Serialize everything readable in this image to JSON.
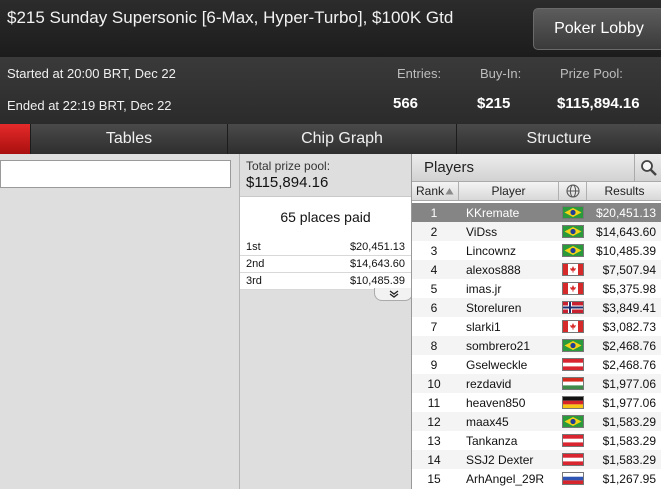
{
  "header": {
    "title": "$215 Sunday Supersonic [6-Max, Hyper-Turbo], $100K Gtd",
    "lobby_button": "Poker Lobby"
  },
  "info": {
    "started": "Started at 20:00 BRT, Dec 22",
    "ended": "Ended at 22:19 BRT, Dec 22",
    "entries_label": "Entries:",
    "entries_value": "566",
    "buyin_label": "Buy-In:",
    "buyin_value": "$215",
    "prizepool_label": "Prize Pool:",
    "prizepool_value": "$115,894.16"
  },
  "tabs": [
    {
      "label": ""
    },
    {
      "label": "Tables"
    },
    {
      "label": "Chip Graph"
    },
    {
      "label": "Structure"
    }
  ],
  "prize_panel": {
    "total_label": "Total prize pool:",
    "total_value": "$115,894.16",
    "places_paid": "65 places paid",
    "payouts": [
      {
        "place": "1st",
        "amount": "$20,451.13"
      },
      {
        "place": "2nd",
        "amount": "$14,643.60"
      },
      {
        "place": "3rd",
        "amount": "$10,485.39"
      }
    ]
  },
  "players": {
    "title": "Players",
    "columns": {
      "rank": "Rank",
      "player": "Player",
      "results": "Results"
    },
    "rows": [
      {
        "rank": "1",
        "name": "KKremate",
        "flag": "brazil-flag-icon",
        "result": "$20,451.13"
      },
      {
        "rank": "2",
        "name": "ViDss",
        "flag": "brazil-flag-icon",
        "result": "$14,643.60"
      },
      {
        "rank": "3",
        "name": "Lincownz",
        "flag": "brazil-flag-icon",
        "result": "$10,485.39"
      },
      {
        "rank": "4",
        "name": "alexos888",
        "flag": "canada-flag-icon",
        "result": "$7,507.94"
      },
      {
        "rank": "5",
        "name": "imas.jr",
        "flag": "canada-flag-icon",
        "result": "$5,375.98"
      },
      {
        "rank": "6",
        "name": "Storeluren",
        "flag": "norway-flag-icon",
        "result": "$3,849.41"
      },
      {
        "rank": "7",
        "name": "slarki1",
        "flag": "canada-flag-icon",
        "result": "$3,082.73"
      },
      {
        "rank": "8",
        "name": "sombrero21",
        "flag": "brazil-flag-icon",
        "result": "$2,468.76"
      },
      {
        "rank": "9",
        "name": "Gselweckle",
        "flag": "austria-flag-icon",
        "result": "$2,468.76"
      },
      {
        "rank": "10",
        "name": "rezdavid",
        "flag": "hungary-flag-icon",
        "result": "$1,977.06"
      },
      {
        "rank": "11",
        "name": "heaven850",
        "flag": "germany-flag-icon",
        "result": "$1,977.06"
      },
      {
        "rank": "12",
        "name": "maax45",
        "flag": "brazil-flag-icon",
        "result": "$1,583.29"
      },
      {
        "rank": "13",
        "name": "Tankanza",
        "flag": "austria-flag-icon",
        "result": "$1,583.29"
      },
      {
        "rank": "14",
        "name": "SSJ2 Dexter",
        "flag": "austria-flag-icon",
        "result": "$1,583.29"
      },
      {
        "rank": "15",
        "name": "ArhAngel_29R",
        "flag": "russia-flag-icon",
        "result": "$1,267.95"
      }
    ]
  },
  "colors": {
    "accent_red": "#d81e1e",
    "selected_row": "#858585"
  }
}
